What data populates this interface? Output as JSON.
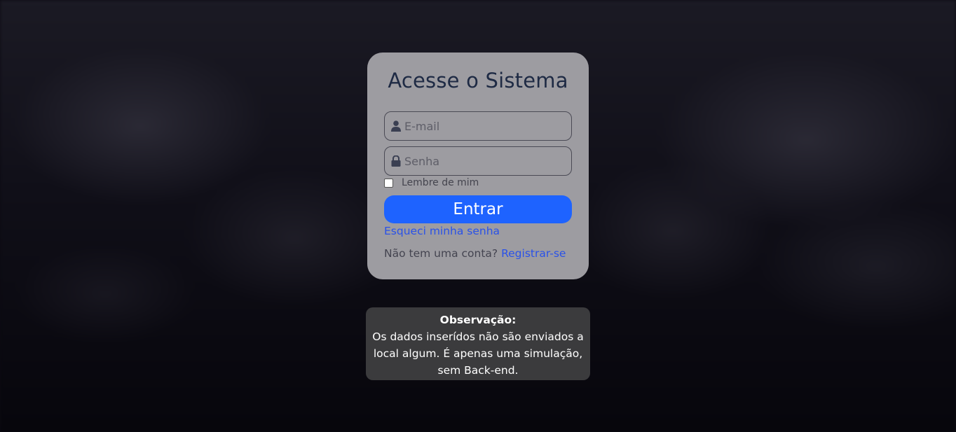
{
  "login": {
    "title": "Acesse o Sistema",
    "email_placeholder": "E-mail",
    "password_placeholder": "Senha",
    "remember_label": "Lembre de mim",
    "submit_label": "Entrar",
    "forgot_link": "Esqueci minha senha",
    "signup_prompt": "Não tem uma conta?",
    "signup_link": "Registrar-se"
  },
  "note": {
    "title": "Observação:",
    "body": "Os dados inserídos não são enviados a local algum. É apenas uma simulação, sem Back-end."
  },
  "icons": {
    "email_icon": "user-icon",
    "password_icon": "lock-icon"
  },
  "colors": {
    "accent": "#1e63ff",
    "link": "#2a52e8",
    "card_bg": "#9d9ca1",
    "title_text": "#1e2a44",
    "note_bg": "#3b3b3d"
  }
}
